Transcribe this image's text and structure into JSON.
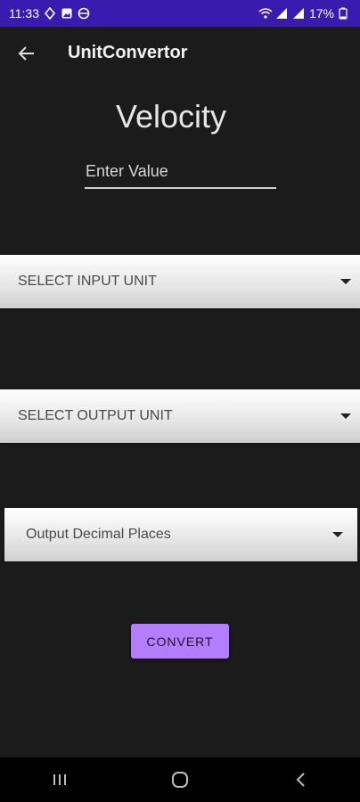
{
  "status_bar": {
    "time": "11:33",
    "battery": "17%",
    "icons": [
      "maps-icon",
      "gallery-icon",
      "vpn-icon",
      "wifi-icon",
      "signal-icon",
      "signal-icon",
      "battery-icon"
    ]
  },
  "app_bar": {
    "title": "UnitConvertor",
    "back_icon": "arrow-back-icon"
  },
  "main": {
    "heading": "Velocity",
    "value_input": {
      "placeholder": "Enter Value",
      "value": ""
    },
    "input_unit_dropdown": {
      "label": "SELECT INPUT UNIT"
    },
    "output_unit_dropdown": {
      "label": "SELECT OUTPUT UNIT"
    },
    "decimal_dropdown": {
      "label": "Output Decimal Places"
    },
    "convert_button": {
      "label": "CONVERT"
    }
  },
  "nav_bar": {
    "items": [
      "recents-icon",
      "home-icon",
      "back-icon"
    ]
  },
  "colors": {
    "status_bar_bg": "#3a1bb0",
    "background": "#1b1b1b",
    "accent_button": "#b47cff"
  }
}
